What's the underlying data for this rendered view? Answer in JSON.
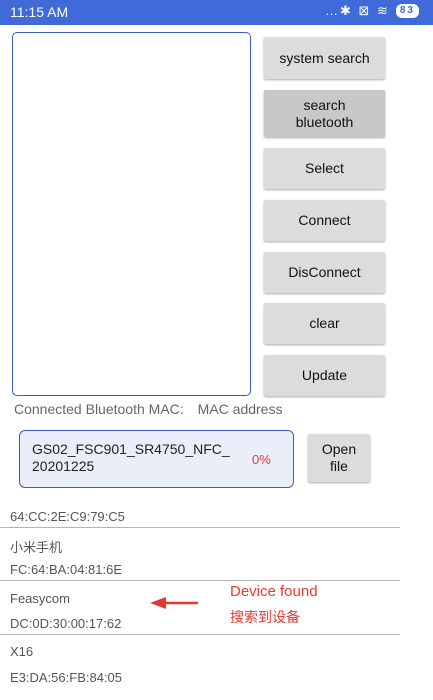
{
  "status_bar": {
    "time": "11:15 AM",
    "icons": "…✱ ⊠ ≋",
    "battery": "83"
  },
  "buttons": {
    "system_search": "system search",
    "search_bluetooth": "search\nbluetooth",
    "select": "Select",
    "connect": "Connect",
    "disconnect": "DisConnect",
    "clear": "clear",
    "update": "Update"
  },
  "connection": {
    "label": "Connected Bluetooth MAC:",
    "value": "MAC address"
  },
  "firmware": {
    "file_name": "GS02_FSC901_SR4750_NFC_ 20201225",
    "progress_text": "0%",
    "open_file_label": "Open\nfile"
  },
  "devices": [
    {
      "mac": "64:CC:2E:C9:79:C5"
    },
    {
      "name": "小米手机",
      "mac": "FC:64:BA:04:81:6E"
    },
    {
      "name": "Feasycom",
      "mac": "DC:0D:30:00:17:62"
    },
    {
      "name": "X16",
      "mac": "E3:DA:56:FB:84:05"
    }
  ],
  "annotation": {
    "english": "Device found",
    "chinese": "搜索到设备",
    "color": "#e53935"
  }
}
